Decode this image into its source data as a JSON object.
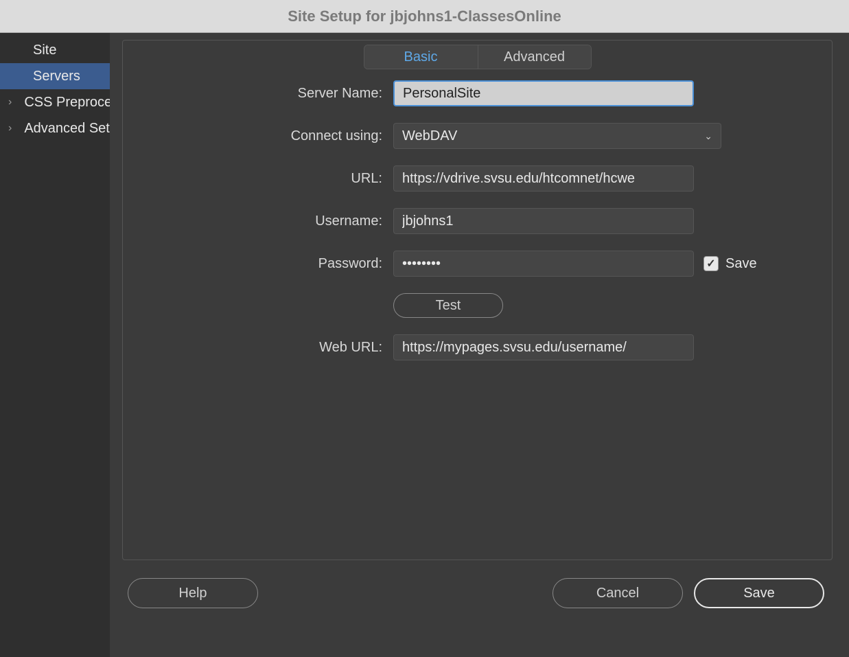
{
  "title": "Site Setup for jbjohns1-ClassesOnline",
  "sidebar": {
    "items": [
      {
        "label": "Site",
        "has_chevron": false,
        "selected": false
      },
      {
        "label": "Servers",
        "has_chevron": false,
        "selected": true
      },
      {
        "label": "CSS Preprocessors",
        "has_chevron": true,
        "selected": false
      },
      {
        "label": "Advanced Settings",
        "has_chevron": true,
        "selected": false
      }
    ]
  },
  "tabs": {
    "basic": "Basic",
    "advanced": "Advanced"
  },
  "form": {
    "server_name": {
      "label": "Server Name:",
      "value": "PersonalSite"
    },
    "connect_using": {
      "label": "Connect using:",
      "value": "WebDAV"
    },
    "url": {
      "label": "URL:",
      "value": "https://vdrive.svsu.edu/htcomnet/hcwe"
    },
    "username": {
      "label": "Username:",
      "value": "jbjohns1"
    },
    "password": {
      "label": "Password:",
      "value": "••••••••",
      "save_checked": true,
      "save_label": "Save"
    },
    "test_label": "Test",
    "web_url": {
      "label": "Web URL:",
      "value": "https://mypages.svsu.edu/username/"
    }
  },
  "buttons": {
    "help": "Help",
    "cancel": "Cancel",
    "save": "Save"
  }
}
